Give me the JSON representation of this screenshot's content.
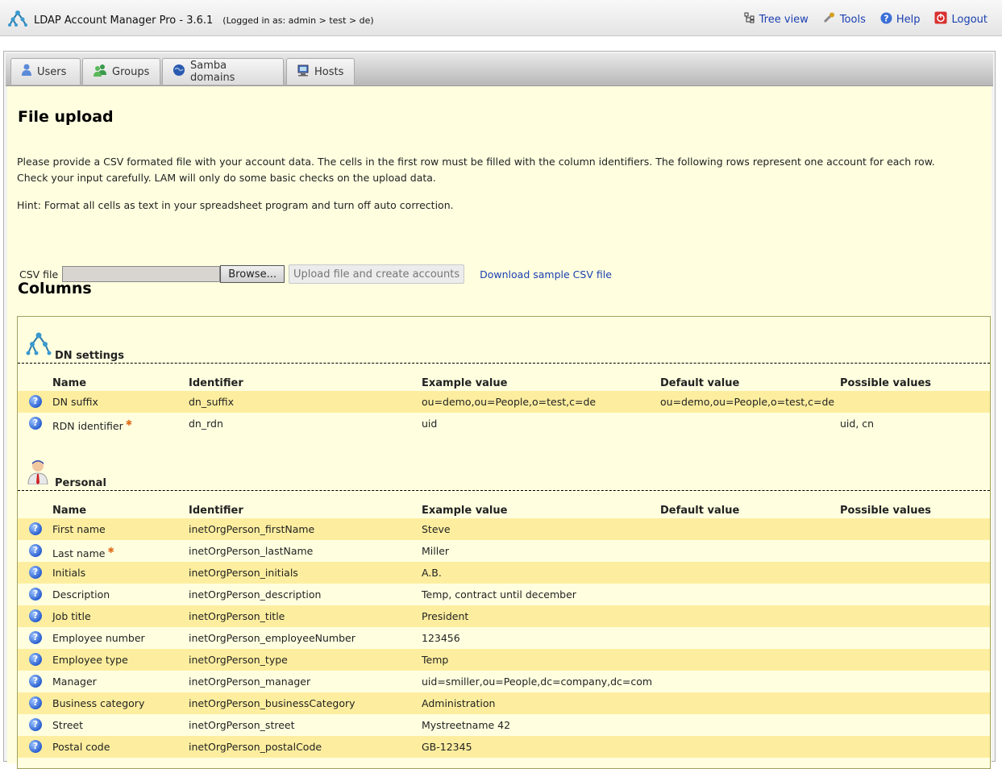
{
  "header": {
    "title": "LDAP Account Manager Pro - 3.6.1",
    "login_info": "(Logged in as: admin > test > de)",
    "links": [
      {
        "label": "Tree view",
        "icon": "tree-icon"
      },
      {
        "label": "Tools",
        "icon": "tools-icon"
      },
      {
        "label": "Help",
        "icon": "help-icon"
      },
      {
        "label": "Logout",
        "icon": "logout-icon"
      }
    ]
  },
  "tabs": [
    {
      "label": "Users",
      "icon": "user-icon"
    },
    {
      "label": "Groups",
      "icon": "group-icon"
    },
    {
      "label": "Samba domains",
      "icon": "samba-icon"
    },
    {
      "label": "Hosts",
      "icon": "host-icon"
    }
  ],
  "page": {
    "title": "File upload",
    "intro_line1": "Please provide a CSV formated file with your account data. The cells in the first row must be filled with the column identifiers. The following rows represent one account for each row.",
    "intro_line2": "Check your input carefully. LAM will only do some basic checks on the upload data.",
    "hint": "Hint: Format all cells as text in your spreadsheet program and turn off auto correction.",
    "csv_label": "CSV file",
    "browse_label": "Browse...",
    "upload_label": "Upload file and create accounts",
    "download_label": "Download sample CSV file",
    "columns_title": "Columns"
  },
  "table_headers": {
    "name": "Name",
    "identifier": "Identifier",
    "example": "Example value",
    "default": "Default value",
    "possible": "Possible values"
  },
  "sections": [
    {
      "title": "DN settings",
      "icon": "dn-tree-icon",
      "rows": [
        {
          "name": "DN suffix",
          "required": false,
          "identifier": "dn_suffix",
          "example": "ou=demo,ou=People,o=test,c=de",
          "default": "ou=demo,ou=People,o=test,c=de",
          "possible": ""
        },
        {
          "name": "RDN identifier",
          "required": true,
          "identifier": "dn_rdn",
          "example": "uid",
          "default": "",
          "possible": "uid, cn"
        }
      ]
    },
    {
      "title": "Personal",
      "icon": "person-icon",
      "rows": [
        {
          "name": "First name",
          "required": false,
          "identifier": "inetOrgPerson_firstName",
          "example": "Steve",
          "default": "",
          "possible": ""
        },
        {
          "name": "Last name",
          "required": true,
          "identifier": "inetOrgPerson_lastName",
          "example": "Miller",
          "default": "",
          "possible": ""
        },
        {
          "name": "Initials",
          "required": false,
          "identifier": "inetOrgPerson_initials",
          "example": "A.B.",
          "default": "",
          "possible": ""
        },
        {
          "name": "Description",
          "required": false,
          "identifier": "inetOrgPerson_description",
          "example": "Temp, contract until december",
          "default": "",
          "possible": ""
        },
        {
          "name": "Job title",
          "required": false,
          "identifier": "inetOrgPerson_title",
          "example": "President",
          "default": "",
          "possible": ""
        },
        {
          "name": "Employee number",
          "required": false,
          "identifier": "inetOrgPerson_employeeNumber",
          "example": "123456",
          "default": "",
          "possible": ""
        },
        {
          "name": "Employee type",
          "required": false,
          "identifier": "inetOrgPerson_type",
          "example": "Temp",
          "default": "",
          "possible": ""
        },
        {
          "name": "Manager",
          "required": false,
          "identifier": "inetOrgPerson_manager",
          "example": "uid=smiller,ou=People,dc=company,dc=com",
          "default": "",
          "possible": ""
        },
        {
          "name": "Business category",
          "required": false,
          "identifier": "inetOrgPerson_businessCategory",
          "example": "Administration",
          "default": "",
          "possible": ""
        },
        {
          "name": "Street",
          "required": false,
          "identifier": "inetOrgPerson_street",
          "example": "Mystreetname 42",
          "default": "",
          "possible": ""
        },
        {
          "name": "Postal code",
          "required": false,
          "identifier": "inetOrgPerson_postalCode",
          "example": "GB-12345",
          "default": "",
          "possible": ""
        }
      ]
    }
  ]
}
